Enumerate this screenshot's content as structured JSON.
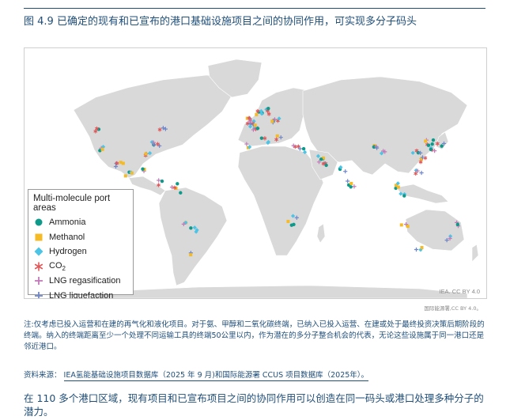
{
  "figure": {
    "title": "图 4.9 已确定的现有和已宣布的港口基础设施项目之间的协同作用，可实现多分子码头"
  },
  "legend": {
    "title": "Multi-molecule port areas",
    "items": [
      {
        "key": "ammonia",
        "label": "Ammonia",
        "color": "#0e9a8a",
        "icon": "circle-icon"
      },
      {
        "key": "methanol",
        "label": "Methanol",
        "color": "#f4bb26",
        "icon": "square-icon"
      },
      {
        "key": "hydrogen",
        "label": "Hydrogen",
        "color": "#4cc4e6",
        "icon": "diamond-icon"
      },
      {
        "key": "co2",
        "label": "CO",
        "sub": "2",
        "color": "#e0585a",
        "icon": "asterisk-icon"
      },
      {
        "key": "lng_regas",
        "label": "LNG regasification",
        "color": "#c27ab8",
        "icon": "plus-icon"
      },
      {
        "key": "lng_liq",
        "label": "LNG liquefaction",
        "color": "#6f86c9",
        "icon": "plus-icon"
      }
    ]
  },
  "map": {
    "credit": "IEA. CC BY 4.0",
    "credit_cn": "国际能源署,CC BY 4.0。",
    "land_color": "#d9d9d9",
    "water_color": "#ffffff"
  },
  "note": {
    "text": "注:仅考虑已投入运营和在建的再气化和液化项目。对于氨、甲醇和二氧化碳终端，已纳入已投入运营、在建或处于最终投资决策后期阶段的终端。纳入的终端距离至少一个处理不同运输工具的终端50公里以内，作为潜在的多分子整合机会的代表，无论这些设施属于同一港口还是邻近港口。"
  },
  "source": {
    "prefix": "资料来源：",
    "link_text": "IEA氢能基础设施项目数据库（2025 年 9 月)和国际能源署 CCUS 项目数据库（2025年）。"
  },
  "summary": {
    "text": "在 110 多个港口区域，现有项目和已宣布项目之间的协同作用可以创造在同一码头或港口处理多种分子的潜力。"
  }
}
